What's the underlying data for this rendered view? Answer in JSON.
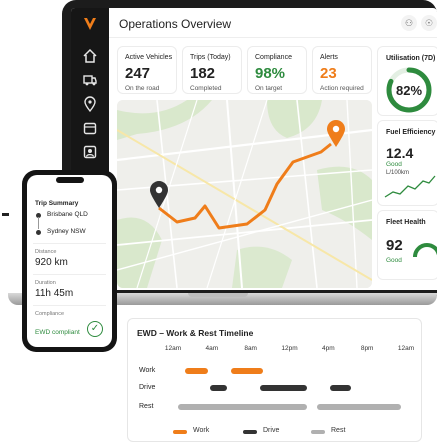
{
  "dashboard": {
    "title": "Operations Overview",
    "kpis": [
      {
        "label": "Active Vehicles",
        "value": "247",
        "sub": "On the road"
      },
      {
        "label": "Trips (Today)",
        "value": "182",
        "sub": "Completed"
      },
      {
        "label": "Compliance",
        "value": "98%",
        "sub": "On target"
      },
      {
        "label": "Alerts",
        "value": "23",
        "sub": "Action required"
      }
    ],
    "utilisation": {
      "label": "Utilisation (7D)",
      "value": "82%",
      "fraction": 0.82
    },
    "fuel": {
      "label": "Fuel Efficiency",
      "value": "12.4",
      "unit": "L/100km",
      "status": "Good"
    },
    "fleet_health": {
      "label": "Fleet Health",
      "value": "92",
      "status": "Good",
      "fraction": 0.92
    },
    "colors": {
      "accent": "#ef7d1a",
      "good": "#2e8b3e",
      "dark": "#161616"
    }
  },
  "phone": {
    "title": "Trip Summary",
    "origin": "Brisbane QLD",
    "destination": "Sydney NSW",
    "distance_label": "Distance",
    "distance": "920 km",
    "duration_label": "Duration",
    "duration": "11h 45m",
    "compliance_label": "Compliance",
    "compliance": "EWD compliant"
  },
  "ewd": {
    "title": "EWD – Work & Rest Timeline",
    "ticks": [
      "12am",
      "4am",
      "8am",
      "12pm",
      "4pm",
      "8pm",
      "12am"
    ],
    "rows": [
      {
        "label": "Work",
        "color": "#ef7d1a",
        "segments": [
          [
            1.2,
            3.6
          ],
          [
            6.0,
            9.3
          ]
        ]
      },
      {
        "label": "Drive",
        "color": "#333333",
        "segments": [
          [
            3.8,
            5.6
          ],
          [
            9.0,
            13.8
          ],
          [
            16.2,
            18.3
          ]
        ]
      },
      {
        "label": "Rest",
        "color": "#b0b0b0",
        "segments": [
          [
            0.5,
            13.8
          ],
          [
            14.8,
            23.5
          ]
        ]
      }
    ],
    "legend": [
      {
        "label": "Work",
        "color": "#ef7d1a"
      },
      {
        "label": "Drive",
        "color": "#333333"
      },
      {
        "label": "Rest",
        "color": "#b0b0b0"
      }
    ]
  }
}
